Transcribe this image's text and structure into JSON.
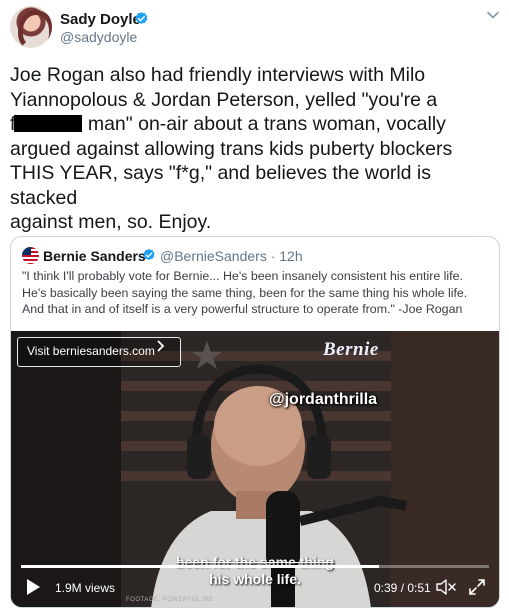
{
  "author": {
    "name": "Sady Doyle",
    "handle": "@sadydoyle"
  },
  "tweet": {
    "line1": "Joe Rogan also had friendly interviews with Milo",
    "line2": "Yiannopolous & Jordan Peterson, yelled \"you're a",
    "line3_start": "f",
    "line3_end": " man\" on-air about a trans woman, vocally",
    "line4": "argued against allowing trans kids puberty blockers",
    "line5": "THIS YEAR, says \"f*g,\" and believes the world is stacked",
    "line6": "against men, so. Enjoy."
  },
  "quote": {
    "name": "Bernie Sanders",
    "handle": "@BernieSanders",
    "time": "· 12h",
    "text_line1": "\"I think I'll probably vote for Bernie... He's been insanely consistent his entire life.",
    "text_line2": "He's basically been saying the same thing, been for the same thing his whole life.",
    "text_line3": "And that in and of itself is a very powerful structure to operate from.\" -Joe Rogan"
  },
  "video": {
    "link_label": "Visit berniesanders.com",
    "logo_text": "Bernie",
    "watermark": "@jordanthrilla",
    "caption_line1": "been for the same thing",
    "caption_line2": "his whole life.",
    "footage_credit": "FOOTAGE: POWERFULJRE",
    "views": "1.9M views",
    "time": "0:39 / 0:51",
    "progress": 0.765
  },
  "colors": {
    "verified": "#1da1f2",
    "muted_text": "#657786",
    "border": "#ccd6dd"
  },
  "icons": [
    "verified-badge-icon",
    "chevron-down-icon",
    "chevron-right-icon",
    "play-icon",
    "mute-icon",
    "expand-icon"
  ]
}
